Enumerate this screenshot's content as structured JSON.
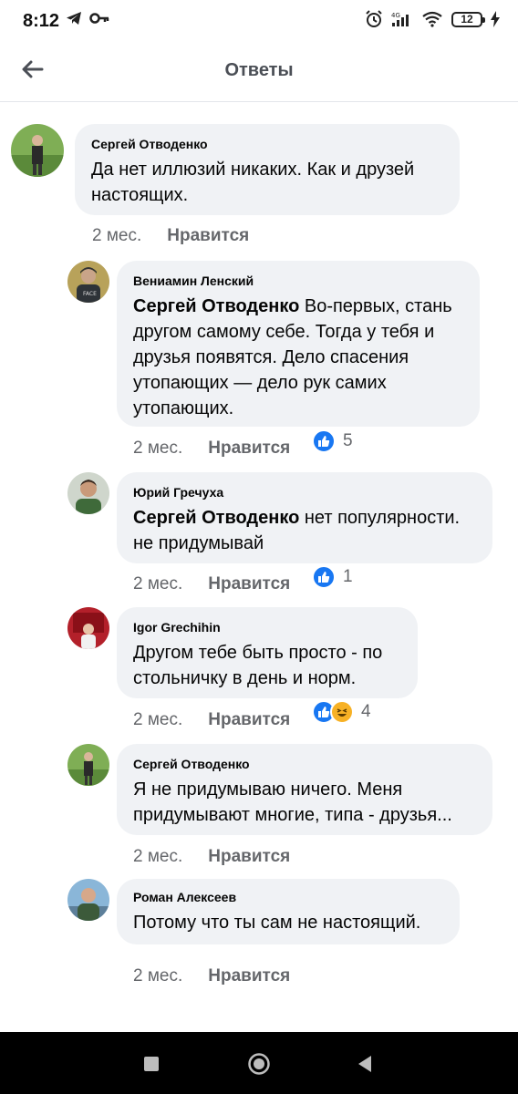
{
  "status": {
    "time": "8:12",
    "battery": "12",
    "left_icons": [
      "telegram-icon",
      "key-icon"
    ],
    "right_icons": [
      "alarm-icon",
      "signal-icon",
      "wifi-icon",
      "battery-icon",
      "charging-icon"
    ]
  },
  "header": {
    "title": "Ответы",
    "back_icon": "arrow-left-icon"
  },
  "comments": [
    {
      "author": "Сергей Отводенко",
      "mention": "",
      "text": "Да нет иллюзий никаких. Как и друзей настоящих.",
      "age": "2 мес.",
      "like": "Нравится",
      "reactions": ""
    },
    {
      "author": "Вениамин Ленский",
      "mention": "Сергей Отводенко",
      "text": " Во-первых, стань другом самому себе. Тогда у тебя и друзья появятся. Дело спасения утопающих — дело рук самих утопающих.",
      "age": "2 мес.",
      "like": "Нравится",
      "reactions": "5"
    },
    {
      "author": "Юрий Гречуха",
      "mention": "Сергей Отводенко",
      "text": " нет популярности. не придумывай",
      "age": "2 мес.",
      "like": "Нравится",
      "reactions": "1"
    },
    {
      "author": "Igor Grechihin",
      "mention": "",
      "text": "Другом тебе быть просто - по стольничку в день и норм.",
      "age": "2 мес.",
      "like": "Нравится",
      "reactions": "4"
    },
    {
      "author": "Сергей Отводенко",
      "mention": "",
      "text": "Я не придумываю ничего. Меня придумывают многие, типа - друзья...",
      "age": "2 мес.",
      "like": "Нравится",
      "reactions": ""
    },
    {
      "author": "Роман Алексеев",
      "mention": "",
      "text": "Потому что ты сам не настоящий.",
      "age": "2 мес.",
      "like": "Нравится",
      "reactions": ""
    }
  ],
  "nav": {
    "buttons": [
      "square-icon",
      "circle-icon",
      "triangle-back-icon"
    ]
  },
  "colors": {
    "bubble": "#f0f2f5",
    "like_blue": "#1877f2",
    "haha_yellow": "#f7b125",
    "meta_gray": "#65676b"
  }
}
